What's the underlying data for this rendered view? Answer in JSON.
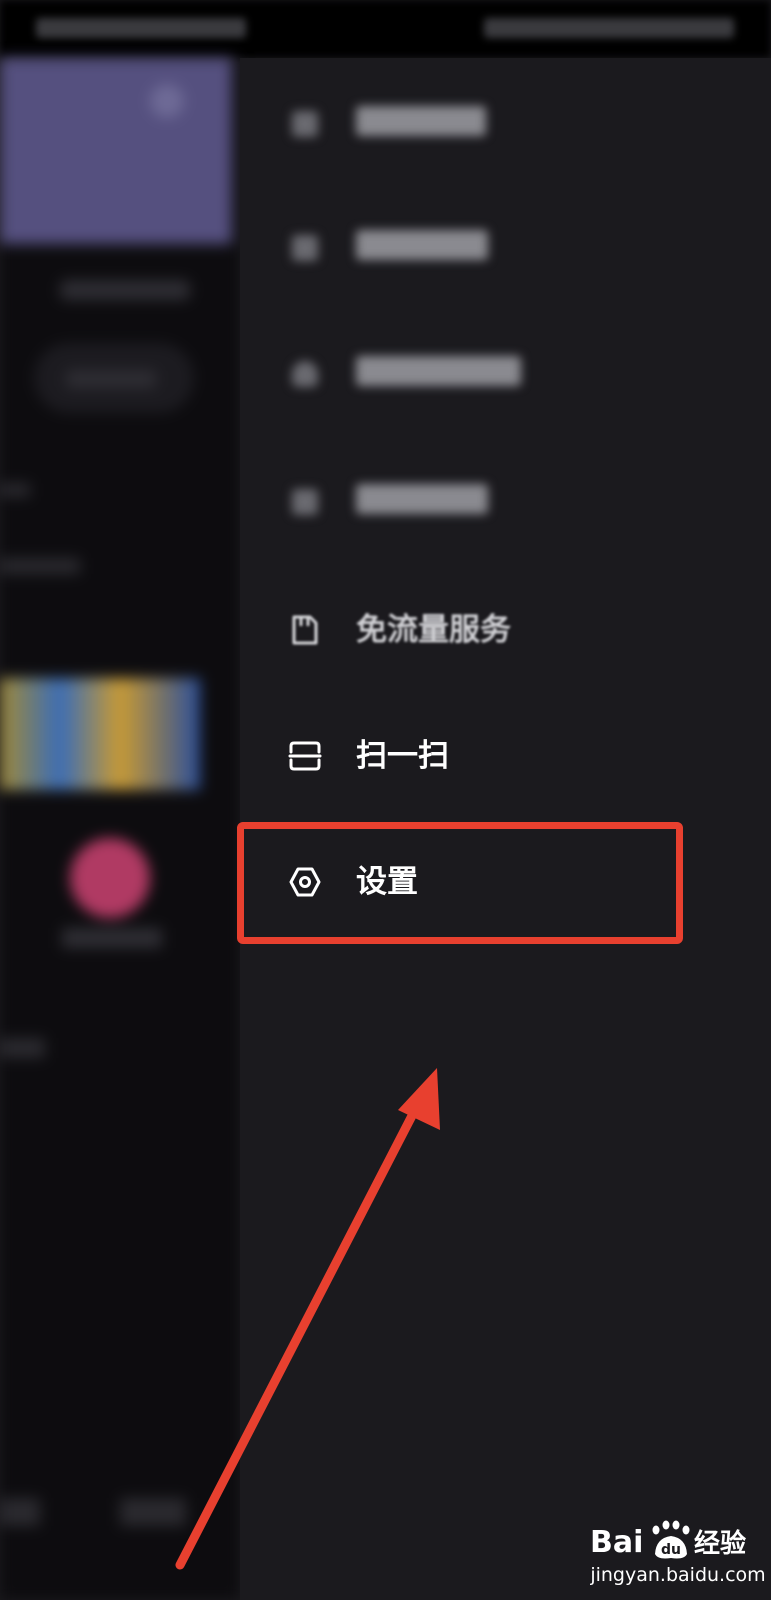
{
  "menu": {
    "items": [
      {
        "label": "",
        "icon": "square-icon",
        "blurred": true
      },
      {
        "label": "",
        "icon": "square-icon",
        "blurred": true
      },
      {
        "label": "",
        "icon": "heart-icon",
        "blurred": true
      },
      {
        "label": "",
        "icon": "document-icon",
        "blurred": true
      },
      {
        "label": "免流量服务",
        "icon": "sim-card-icon",
        "blurred": false
      },
      {
        "label": "扫一扫",
        "icon": "scan-icon",
        "blurred": false
      },
      {
        "label": "设置",
        "icon": "settings-icon",
        "blurred": false
      }
    ]
  },
  "annotation": {
    "highlight_color": "#e8402f",
    "highlighted_item": "设置"
  },
  "watermark": {
    "brand": "Bai du 经验",
    "url": "jingyan.baidu.com"
  },
  "colors": {
    "drawer_bg": "#1b1a1e",
    "banner": "#55507f",
    "avatar": "#b03a63"
  }
}
